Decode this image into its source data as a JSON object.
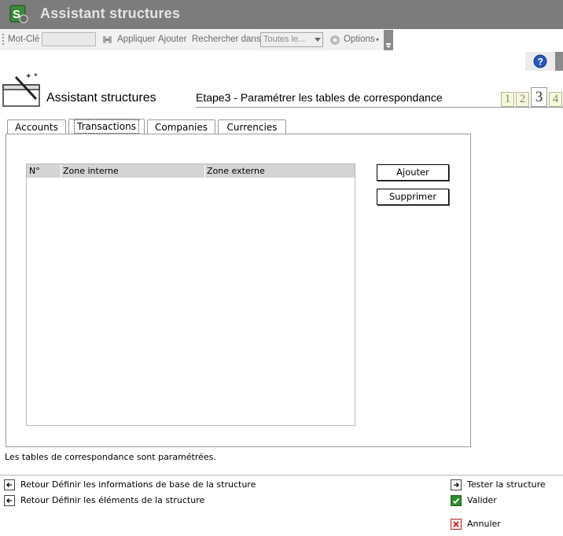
{
  "window": {
    "title": "Assistant structures"
  },
  "toolbar": {
    "keyword_label": "Mot-Clé",
    "keyword_value": "",
    "apply_label": "Appliquer",
    "add_label": "Ajouter",
    "search_in_label": "Rechercher dans",
    "search_in_value": "Toutes le...",
    "options_label": "Options"
  },
  "wizard": {
    "title": "Assistant structures",
    "step_title": "Etape3 - Paramétrer les tables de correspondance",
    "steps": [
      "1",
      "2",
      "3",
      "4"
    ],
    "active_step": 3
  },
  "tabs": [
    {
      "label": "Accounts"
    },
    {
      "label": "Transactions"
    },
    {
      "label": "Companies"
    },
    {
      "label": "Currencies"
    }
  ],
  "active_tab": "Transactions",
  "grid": {
    "columns": [
      "N°",
      "Zone interne",
      "Zone externe"
    ],
    "rows": []
  },
  "buttons": {
    "add": "Ajouter",
    "delete": "Supprimer"
  },
  "status": "Les tables de correspondance sont paramétrées.",
  "nav": {
    "back1": "Retour Définir les informations de base de la structure",
    "back2": "Retour Définir les éléments de la structure",
    "test": "Tester la structure",
    "validate": "Valider",
    "cancel": "Annuler"
  },
  "colors": {
    "titlebar": "#7c7c7c",
    "toolbar": "#f1f1f1",
    "grid_header": "#d4d4d4",
    "accent_green": "#2e8b2e",
    "accent_red": "#b03030"
  }
}
